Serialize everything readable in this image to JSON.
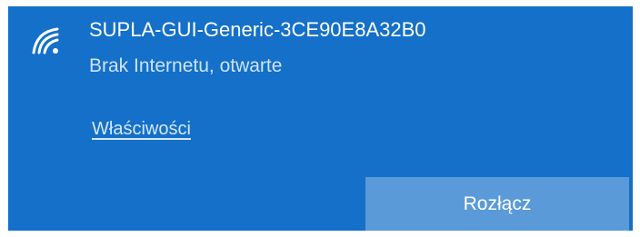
{
  "network": {
    "ssid": "SUPLA-GUI-Generic-3CE90E8A32B0",
    "status": "Brak Internetu, otwarte",
    "icon": "wifi-icon"
  },
  "actions": {
    "properties_label": "Właściwości",
    "disconnect_label": "Rozłącz"
  },
  "colors": {
    "panel_bg": "#1470c8",
    "button_bg": "#5a9ad8",
    "primary_text": "#ffffff",
    "secondary_text": "#cfe3f6"
  }
}
